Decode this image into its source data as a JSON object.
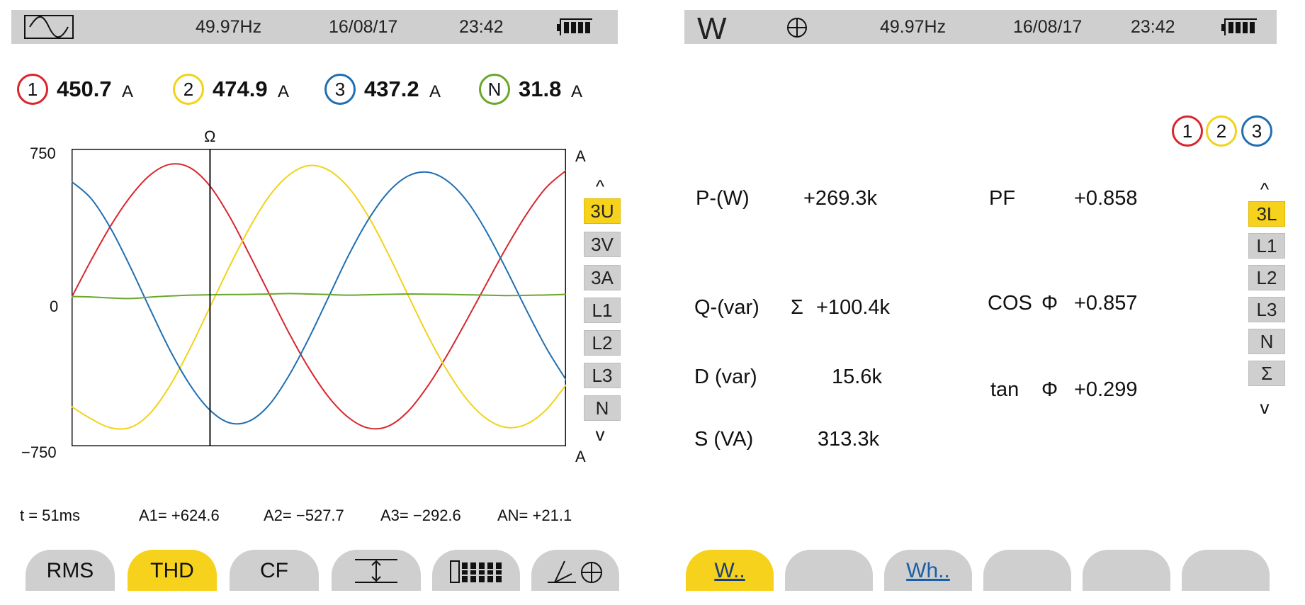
{
  "left": {
    "status": {
      "frequency": "49.97Hz",
      "date": "16/08/17",
      "time": "23:42",
      "mode_icon": "waveform-icon",
      "battery_icon": "battery-icon"
    },
    "phases": [
      {
        "id": "1",
        "value": "450.7",
        "unit": "A",
        "color": "#d9262c"
      },
      {
        "id": "2",
        "value": "474.9",
        "unit": "A",
        "color": "#f1d31a"
      },
      {
        "id": "3",
        "value": "437.2",
        "unit": "A",
        "color": "#1f6fb2"
      },
      {
        "id": "N",
        "value": "31.8",
        "unit": "A",
        "color": "#6aa72c"
      }
    ],
    "cursor_marker": "Ω",
    "axis": {
      "top_unit": "A",
      "bottom_unit": "A",
      "y_max": "750",
      "y_zero": "0",
      "y_min": "−750"
    },
    "side_menu": {
      "up_arrow": "^",
      "items": [
        "3U",
        "3V",
        "3A",
        "L1",
        "L2",
        "L3",
        "N"
      ],
      "active": "3U",
      "down_arrow": "v"
    },
    "readout": {
      "t": "t =   51ms",
      "a1": "A1= +624.6",
      "a2": "A2= −527.7",
      "a3": "A3= −292.6",
      "an": "AN= +21.1"
    },
    "tabs": [
      {
        "label": "RMS",
        "active": false
      },
      {
        "label": "THD",
        "active": true
      },
      {
        "label": "CF",
        "active": false
      },
      {
        "label": "",
        "icon": "expand-vertical-icon",
        "active": false
      },
      {
        "label": "",
        "icon": "bar-table-icon",
        "active": false
      },
      {
        "label": "",
        "icon": "phasor-icon",
        "active": false
      }
    ]
  },
  "chart_data": {
    "type": "line",
    "title": "",
    "xlabel": "",
    "ylabel": "A",
    "ylim": [
      -750,
      750
    ],
    "x": [
      0,
      2,
      4,
      6,
      8,
      10,
      12,
      14,
      16,
      18,
      20,
      22,
      24,
      26,
      28,
      30,
      32,
      34,
      36,
      38,
      40,
      42,
      44,
      46,
      48,
      50
    ],
    "series": [
      {
        "name": "1",
        "color": "#d9262c",
        "values": [
          0,
          190,
          365,
          512,
          620,
          672,
          654,
          562,
          406,
          215,
          17,
          -180,
          -356,
          -502,
          -605,
          -658,
          -649,
          -575,
          -447,
          -288,
          -110,
          74,
          255,
          420,
          555,
          640
        ]
      },
      {
        "name": "2",
        "color": "#f1d31a",
        "values": [
          -550,
          -612,
          -657,
          -654,
          -580,
          -440,
          -255,
          -48,
          160,
          352,
          512,
          618,
          665,
          642,
          555,
          410,
          222,
          15,
          -190,
          -370,
          -515,
          -612,
          -655,
          -638,
          -565,
          -440
        ]
      },
      {
        "name": "3",
        "color": "#1f6fb2",
        "values": [
          585,
          498,
          345,
          148,
          -65,
          -270,
          -442,
          -568,
          -632,
          -622,
          -540,
          -392,
          -205,
          4,
          212,
          392,
          530,
          612,
          632,
          588,
          485,
          328,
          138,
          -64,
          -254,
          -415
        ]
      },
      {
        "name": "N",
        "color": "#6aa72c",
        "values": [
          5,
          3,
          -2,
          -5,
          2,
          8,
          12,
          14,
          15,
          16,
          18,
          20,
          18,
          15,
          12,
          14,
          16,
          18,
          17,
          16,
          14,
          12,
          10,
          11,
          13,
          16
        ]
      }
    ],
    "cursor_x": 14
  },
  "right": {
    "status": {
      "mode": "W",
      "frequency": "49.97Hz",
      "date": "16/08/17",
      "time": "23:42",
      "crosshair_icon": "crosshair-icon",
      "battery_icon": "battery-icon"
    },
    "phase_indicators": [
      "1",
      "2",
      "3"
    ],
    "measurements": {
      "p_label": "P-(W)",
      "p_value": "+269.3k",
      "q_label": "Q-(var)",
      "q_sigma": "Σ",
      "q_value": "+100.4k",
      "d_label": "D (var)",
      "d_value": "15.6k",
      "s_label": "S (VA)",
      "s_value": "313.3k",
      "pf_label": "PF",
      "pf_value": "+0.858",
      "cos_label": "COS",
      "cos_phi": "Φ",
      "cos_value": "+0.857",
      "tan_label": "tan",
      "tan_phi": "Φ",
      "tan_value": "+0.299"
    },
    "side_menu": {
      "up_arrow": "^",
      "items": [
        "3L",
        "L1",
        "L2",
        "L3",
        "N",
        "Σ"
      ],
      "active": "3L",
      "down_arrow": "v"
    },
    "tabs": [
      {
        "label": "W..",
        "active": true,
        "link": true
      },
      {
        "label": "",
        "active": false
      },
      {
        "label": "Wh..",
        "active": false,
        "link": true
      },
      {
        "label": "",
        "active": false
      },
      {
        "label": "",
        "active": false
      },
      {
        "label": "",
        "active": false
      }
    ]
  }
}
